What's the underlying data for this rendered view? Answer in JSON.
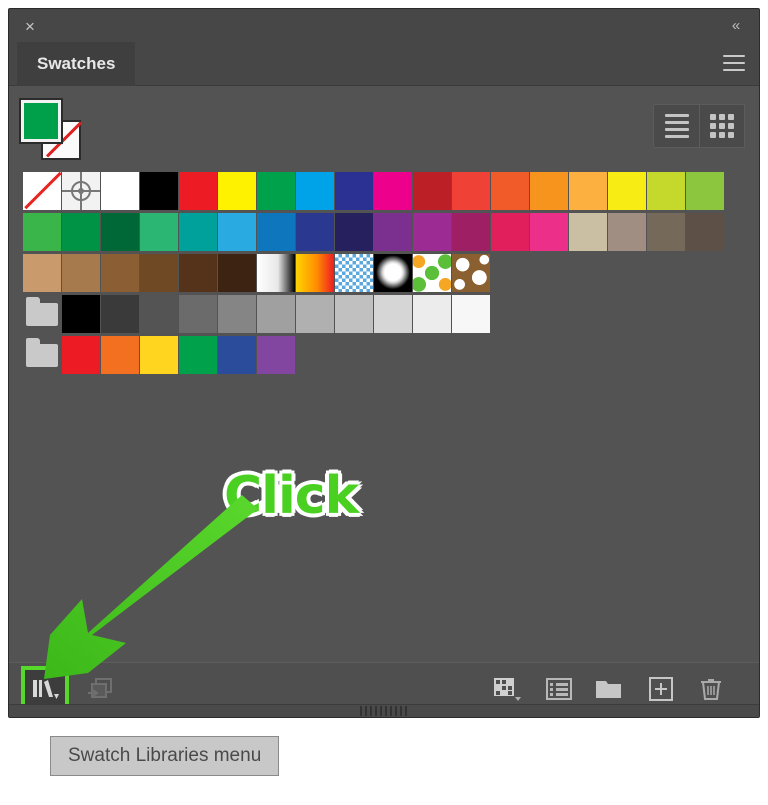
{
  "window": {
    "close_icon": "×",
    "collapse_icon": "«",
    "menu_icon": "hamburger-icon"
  },
  "tabs": [
    {
      "label": "Swatches",
      "active": true
    }
  ],
  "fill_stroke": {
    "fill_color": "#00a04b",
    "stroke_color": "none"
  },
  "view_toggle": {
    "list_label": "list-view",
    "grid_label": "grid-view",
    "active": "grid-view"
  },
  "swatch_grid": {
    "rows": [
      {
        "cells": [
          {
            "type": "none"
          },
          {
            "type": "registration"
          },
          {
            "type": "color",
            "color": "#ffffff"
          },
          {
            "type": "color",
            "color": "#000000"
          },
          {
            "type": "color",
            "color": "#ed1c24"
          },
          {
            "type": "color",
            "color": "#fff200"
          },
          {
            "type": "color",
            "color": "#00a14b"
          },
          {
            "type": "color",
            "color": "#00a2e8"
          },
          {
            "type": "color",
            "color": "#2b3192"
          },
          {
            "type": "color",
            "color": "#ec008c"
          },
          {
            "type": "color",
            "color": "#bc2026"
          },
          {
            "type": "color",
            "color": "#ef4136"
          },
          {
            "type": "color",
            "color": "#f15a29"
          },
          {
            "type": "color",
            "color": "#f7941e"
          },
          {
            "type": "color",
            "color": "#fbb040"
          },
          {
            "type": "color",
            "color": "#f7ec13"
          },
          {
            "type": "color",
            "color": "#c5d92d"
          },
          {
            "type": "color",
            "color": "#8cc63f"
          }
        ]
      },
      {
        "cells": [
          {
            "type": "color",
            "color": "#39b54a"
          },
          {
            "type": "color",
            "color": "#009245"
          },
          {
            "type": "color",
            "color": "#006837"
          },
          {
            "type": "color",
            "color": "#2bb673"
          },
          {
            "type": "color",
            "color": "#00a09b"
          },
          {
            "type": "color",
            "color": "#29abe2"
          },
          {
            "type": "color",
            "color": "#0d76bc"
          },
          {
            "type": "color",
            "color": "#2a388f"
          },
          {
            "type": "color",
            "color": "#26215e"
          },
          {
            "type": "color",
            "color": "#7b2f8e"
          },
          {
            "type": "color",
            "color": "#9c2c93"
          },
          {
            "type": "color",
            "color": "#9e1f63"
          },
          {
            "type": "color",
            "color": "#e01f5c"
          },
          {
            "type": "color",
            "color": "#ec3089"
          },
          {
            "type": "color",
            "color": "#cbbfa3"
          },
          {
            "type": "color",
            "color": "#a08e82"
          },
          {
            "type": "color",
            "color": "#75695a"
          },
          {
            "type": "color",
            "color": "#5c5047"
          }
        ]
      },
      {
        "cells": [
          {
            "type": "color",
            "color": "#c89a6c"
          },
          {
            "type": "color",
            "color": "#a77a4e"
          },
          {
            "type": "color",
            "color": "#8c5e33"
          },
          {
            "type": "color",
            "color": "#6f4824"
          },
          {
            "type": "color",
            "color": "#55331a"
          },
          {
            "type": "color",
            "color": "#3c2312"
          },
          {
            "type": "gradient",
            "name": "white-black-gradient",
            "css": "linear-gradient(to right, #ffffff 0%, #e8e8e8 55%, #000000 100%)"
          },
          {
            "type": "gradient",
            "name": "yellow-red-gradient",
            "css": "linear-gradient(to right, #ffd400 0%, #ff8c00 55%, #ee1c25 100%)"
          },
          {
            "type": "pattern",
            "name": "blue-checker-pattern"
          },
          {
            "type": "pattern",
            "name": "black-white-radial-pattern"
          },
          {
            "type": "pattern",
            "name": "green-floral-pattern"
          },
          {
            "type": "pattern",
            "name": "brown-ornament-pattern"
          }
        ]
      },
      {
        "cells": [
          {
            "type": "folder",
            "name": "grayscale-group"
          },
          {
            "type": "color",
            "color": "#000000"
          },
          {
            "type": "color",
            "color": "#3a3a3a"
          },
          {
            "type": "color",
            "color": "#545454"
          },
          {
            "type": "color",
            "color": "#6b6b6b"
          },
          {
            "type": "color",
            "color": "#858585"
          },
          {
            "type": "color",
            "color": "#a0a0a0"
          },
          {
            "type": "color",
            "color": "#b0b0b0"
          },
          {
            "type": "color",
            "color": "#c0c0c0"
          },
          {
            "type": "color",
            "color": "#d6d6d6"
          },
          {
            "type": "color",
            "color": "#ececec"
          },
          {
            "type": "color",
            "color": "#f7f7f7"
          }
        ]
      },
      {
        "cells": [
          {
            "type": "folder",
            "name": "brights-group"
          },
          {
            "type": "color",
            "color": "#ed1c24"
          },
          {
            "type": "color",
            "color": "#f37021"
          },
          {
            "type": "color",
            "color": "#ffd520"
          },
          {
            "type": "color",
            "color": "#00a14b"
          },
          {
            "type": "color",
            "color": "#2b4b9b"
          },
          {
            "type": "color",
            "color": "#8245a0"
          }
        ]
      }
    ]
  },
  "bottom_bar": {
    "buttons": [
      {
        "name": "swatch-libraries-menu-button",
        "icon": "books-icon",
        "highlighted": true
      },
      {
        "name": "show-swatch-kinds-button",
        "icon": "import-icon",
        "highlighted": false
      },
      {
        "name": "swatch-options-button",
        "icon": "swatch-grid-icon",
        "highlighted": false
      },
      {
        "name": "new-color-group-list-button",
        "icon": "list-icon",
        "highlighted": false
      },
      {
        "name": "new-color-group-button",
        "icon": "folder-icon",
        "highlighted": false
      },
      {
        "name": "new-swatch-button",
        "icon": "plus-box-icon",
        "highlighted": false
      },
      {
        "name": "delete-swatch-button",
        "icon": "trash-icon",
        "highlighted": false
      }
    ]
  },
  "annotations": {
    "click_label": "Click",
    "click_color": "#4ad021",
    "arrow_color": "#4ad021"
  },
  "tooltip": {
    "text": "Swatch Libraries menu"
  }
}
